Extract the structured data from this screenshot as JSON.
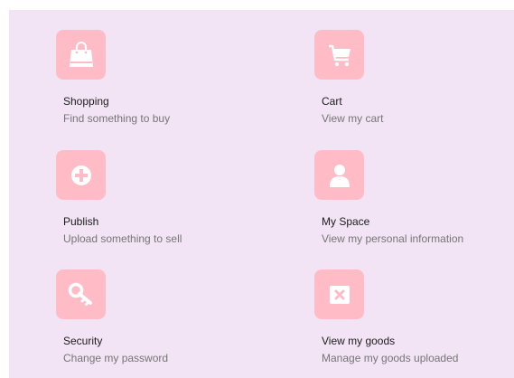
{
  "colors": {
    "panel_background": "#f2e4f5",
    "icon_tile": "#ffbcc7",
    "icon_glyph": "#ffffff",
    "title_text": "#1c1c1c",
    "description_text": "#757575"
  },
  "menu": {
    "items": [
      {
        "icon": "shopping-bag-icon",
        "title": "Shopping",
        "description": "Find something to buy"
      },
      {
        "icon": "cart-icon",
        "title": "Cart",
        "description": "View my cart"
      },
      {
        "icon": "plus-circle-icon",
        "title": "Publish",
        "description": "Upload something to sell"
      },
      {
        "icon": "user-icon",
        "title": "My Space",
        "description": "View my personal information"
      },
      {
        "icon": "key-icon",
        "title": "Security",
        "description": "Change my password"
      },
      {
        "icon": "close-box-icon",
        "title": "View my goods",
        "description": "Manage my goods uploaded"
      }
    ]
  }
}
